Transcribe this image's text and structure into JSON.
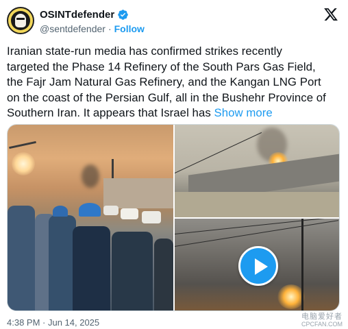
{
  "author": {
    "display_name": "OSINTdefender",
    "handle": "@sentdefender",
    "separator": "·",
    "follow_label": "Follow",
    "verified_icon": "verified-badge-icon",
    "avatar_icon": "masked-face-avatar"
  },
  "platform_logo": "x-logo-icon",
  "tweet": {
    "lines": [
      "Iranian state-run media has confirmed strikes recently",
      "targeted the Phase 14 Refinery of the South Pars Gas Field,",
      "the Fajr Jam Natural Gas Refinery, and the Kangan LNG Port",
      "on the coast of the Persian Gulf, all in the Bushehr Province of",
      "Southern Iran. It appears that Israel has "
    ],
    "show_more_label": "Show more"
  },
  "media": {
    "items": [
      {
        "kind": "photo",
        "subject": "crowd-watching-smoke"
      },
      {
        "kind": "photo",
        "subject": "fire-behind-wall"
      },
      {
        "kind": "video",
        "subject": "fire-under-power-lines",
        "play_icon": "play-icon"
      }
    ]
  },
  "footer": {
    "timestamp": "4:38 PM · Jun 14, 2025",
    "watermark_top": "电脑爱好者",
    "watermark_bottom": "CPCFAN.COM"
  },
  "colors": {
    "accent": "#1d9bf0",
    "text": "#0f1419",
    "secondary_text": "#536471",
    "border": "#cfd9de"
  }
}
